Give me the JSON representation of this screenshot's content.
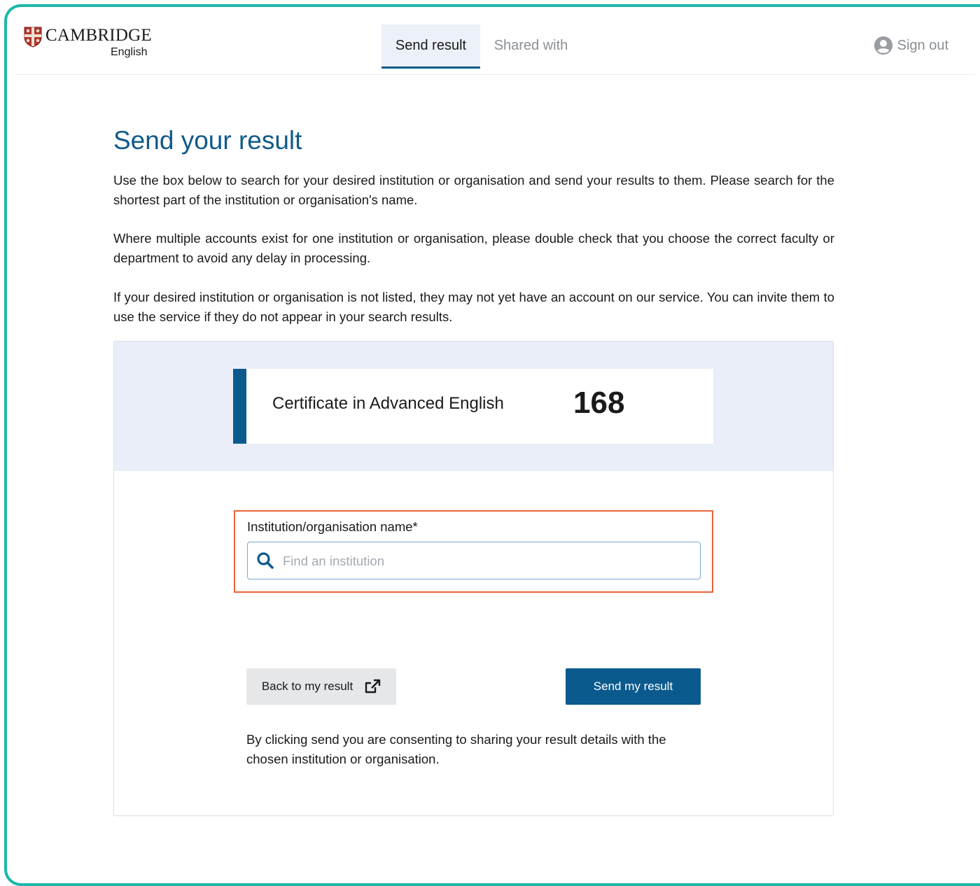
{
  "brand": {
    "name": "CAMBRIDGE",
    "sub": "English",
    "shield_color": "#b3362e"
  },
  "nav": {
    "tabs": [
      {
        "label": "Send result",
        "active": true
      },
      {
        "label": "Shared with",
        "active": false
      }
    ],
    "signout_label": "Sign out",
    "user_icon": "user-circle-icon"
  },
  "page": {
    "title": "Send your result",
    "paragraphs": [
      "Use the box below to search for your desired institution or organisation and send your results to them. Please search for the shortest part of the institution or organisation's name.",
      "Where multiple accounts exist for one institution or organisation, please double check that you choose the correct faculty or department to avoid any delay in processing.",
      "If your desired institution or organisation is not listed, they may not yet have an account on our service. You can invite them to use the service if they do not appear in your search results."
    ]
  },
  "result": {
    "exam_name": "Certificate in Advanced English",
    "score": "168"
  },
  "form": {
    "field_label": "Institution/organisation name*",
    "search_placeholder": "Find an institution",
    "search_value": "",
    "search_icon": "search-icon"
  },
  "actions": {
    "back_label": "Back to my result",
    "back_icon": "external-link-icon",
    "send_label": "Send my result"
  },
  "consent_text": "By clicking send you are consenting to sharing your result details with the chosen institution or organisation.",
  "colors": {
    "frame": "#1db8ac",
    "primary": "#0b5a8e",
    "title": "#105a8b",
    "highlight": "#e8623a",
    "panel": "#e9eef8"
  }
}
